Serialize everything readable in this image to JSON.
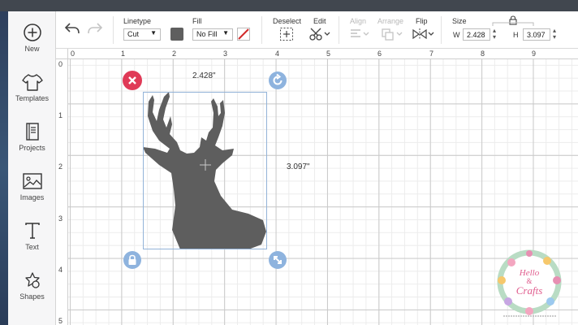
{
  "sidebar": {
    "items": [
      {
        "label": "New",
        "icon": "plus-circle-icon"
      },
      {
        "label": "Templates",
        "icon": "tshirt-icon"
      },
      {
        "label": "Projects",
        "icon": "book-icon"
      },
      {
        "label": "Images",
        "icon": "image-icon"
      },
      {
        "label": "Text",
        "icon": "text-icon"
      },
      {
        "label": "Shapes",
        "icon": "shapes-icon"
      }
    ]
  },
  "toolbar": {
    "linetype_label": "Linetype",
    "linetype_value": "Cut",
    "fill_label": "Fill",
    "fill_value": "No Fill",
    "deselect_label": "Deselect",
    "edit_label": "Edit",
    "align_label": "Align",
    "arrange_label": "Arrange",
    "flip_label": "Flip",
    "size_label": "Size",
    "w_label": "W",
    "w_value": "2.428",
    "h_label": "H",
    "h_value": "3.097",
    "swatch_color": "#5f5f5f"
  },
  "ruler": {
    "top": [
      "0",
      "1",
      "2",
      "3",
      "4",
      "5",
      "6",
      "7",
      "8",
      "9"
    ],
    "left": [
      "0",
      "1",
      "2",
      "3",
      "4",
      "5"
    ]
  },
  "canvas": {
    "width_label": "2.428\"",
    "height_label": "3.097\"",
    "shape_color": "#5e5e5e",
    "delete_color": "#e03a57",
    "handle_color": "#8eb3de"
  },
  "watermark": {
    "line1": "Hello",
    "line2": "&",
    "line3": "Crafts"
  }
}
